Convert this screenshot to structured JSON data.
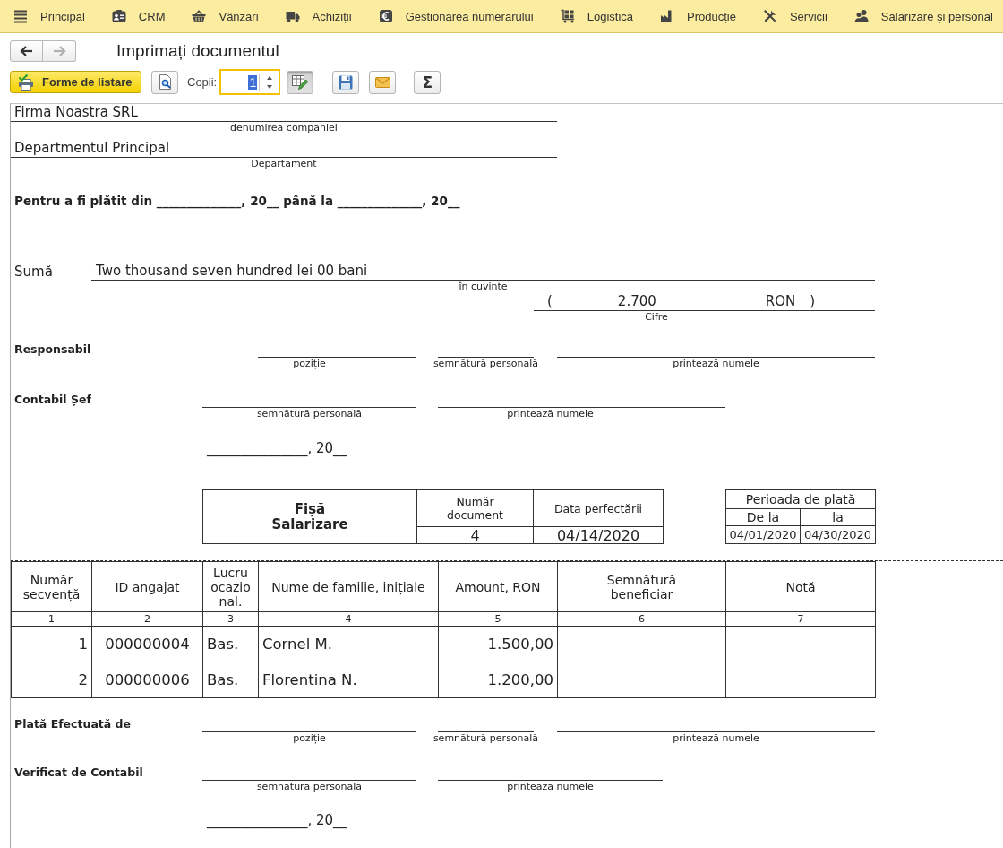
{
  "menu": [
    {
      "label": "Principal"
    },
    {
      "label": "CRM"
    },
    {
      "label": "Vânzări"
    },
    {
      "label": "Achiziții"
    },
    {
      "label": "Gestionarea numerarului"
    },
    {
      "label": "Logistica"
    },
    {
      "label": "Producție"
    },
    {
      "label": "Servicii"
    },
    {
      "label": "Salarizare și personal"
    }
  ],
  "nav_buttons": [
    {
      "disabled": false
    },
    {
      "disabled": true
    }
  ],
  "title": "Imprimați documentul",
  "toolbar": {
    "print_forms_button": "Forme de listare",
    "copies_label": "Copii:",
    "copies": {
      "value": "1",
      "focused": true,
      "value_selected": true
    },
    "edit_mode_on": true,
    "sum_button": "Σ"
  },
  "document": {
    "company": {
      "value": "Firma Noastra SRL",
      "caption": "denumirea companiei"
    },
    "department": {
      "value": "Departmentul Principal",
      "caption": "Departament"
    },
    "pay_period_line": "Pentru a fi plătit din ______________, 20__ până la ______________, 20__",
    "amount": {
      "label": "Sumă",
      "words": "Two thousand seven hundred lei 00 bani",
      "words_caption": "în cuvinte",
      "open_paren": "(",
      "figure": "2.700",
      "currency": "RON",
      "close_paren": ")",
      "figure_caption": "Cifre"
    },
    "approvals": [
      {
        "title": "Responsabil",
        "captions": [
          "poziție",
          "semnătură personală",
          "printează numele"
        ]
      },
      {
        "title": "Contabil Șef",
        "captions": [
          "semnătură personală",
          "printează numele"
        ]
      }
    ],
    "approval_date": "_______________, 20__",
    "form_header": {
      "title": "Fișă\nSalarizare",
      "columns": [
        "Număr\ndocument",
        "Data perfectării"
      ],
      "values": [
        "4",
        "04/14/2020"
      ]
    },
    "pay_period": {
      "title": "Perioada de plată",
      "columns": [
        "De la",
        "la"
      ],
      "values": [
        "04/01/2020",
        "04/30/2020"
      ]
    },
    "table": {
      "columns": [
        {
          "label": "Număr\nsecvență",
          "number": "1"
        },
        {
          "label": "ID angajat",
          "number": "2"
        },
        {
          "label": "Lucru ocazional.",
          "number": "3"
        },
        {
          "label": "Nume de familie, inițiale",
          "number": "4"
        },
        {
          "label": "Amount, RON",
          "number": "5"
        },
        {
          "label": "Semnătură\nbeneficiar",
          "number": "6"
        },
        {
          "label": "Notă",
          "number": "7"
        }
      ],
      "rows": [
        [
          "1",
          "000000004",
          "Bas.",
          "Cornel M.",
          "1.500,00"
        ],
        [
          "2",
          "000000006",
          "Bas.",
          "Florentina N.",
          "1.200,00"
        ]
      ]
    },
    "payments": [
      {
        "title": "Plată Efectuată de",
        "captions": [
          "poziție",
          "semnătură personală",
          "printează numele"
        ]
      },
      {
        "title": "Verificat de Contabil",
        "captions": [
          "semnătură personală",
          "printează numele"
        ]
      }
    ],
    "payment_date": "_______________, 20__"
  }
}
